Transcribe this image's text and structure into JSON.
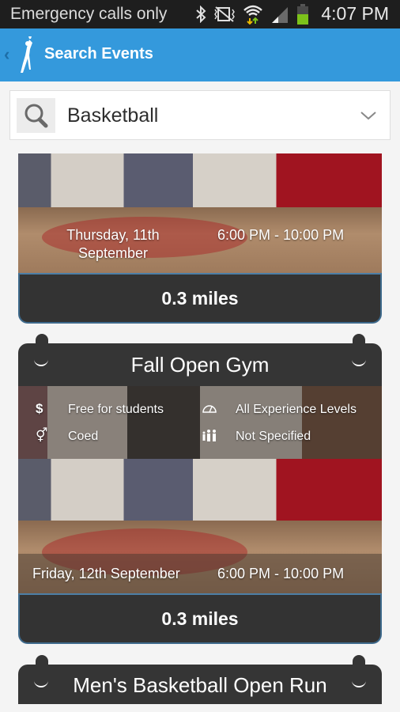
{
  "status_bar": {
    "carrier": "Emergency calls only",
    "time": "4:07 PM",
    "icons": [
      "bluetooth-icon",
      "vibrate-icon",
      "wifi-icon",
      "signal-icon",
      "battery-icon"
    ]
  },
  "app_bar": {
    "back_icon": "chevron-left-icon",
    "logo_icon": "basketball-player-icon",
    "title": "Search Events"
  },
  "search": {
    "icon": "search-icon",
    "value": "Basketball",
    "dropdown_icon": "chevron-down-icon"
  },
  "events": [
    {
      "title": "",
      "date": "Thursday, 11th September",
      "date_line1": "Thursday, 11th",
      "date_line2": "September",
      "time": "6:00 PM - 10:00 PM",
      "distance": "0.3 miles"
    },
    {
      "title": "Fall Open Gym",
      "attributes": {
        "cost": {
          "icon": "dollar-icon",
          "label": "Free for students"
        },
        "level": {
          "icon": "speedometer-icon",
          "label": "All Experience Levels"
        },
        "gender": {
          "icon": "gender-icon",
          "label": "Coed"
        },
        "age": {
          "icon": "people-icon",
          "label": "Not Specified"
        }
      },
      "date": "Friday, 12th September",
      "time": "6:00 PM - 10:00 PM",
      "distance": "0.3 miles"
    },
    {
      "title": "Men's Basketball Open Run"
    }
  ],
  "colors": {
    "accent": "#3499dc",
    "card_dark": "#353535",
    "card_border": "#3e6a8c",
    "battery": "#7cc21a"
  }
}
